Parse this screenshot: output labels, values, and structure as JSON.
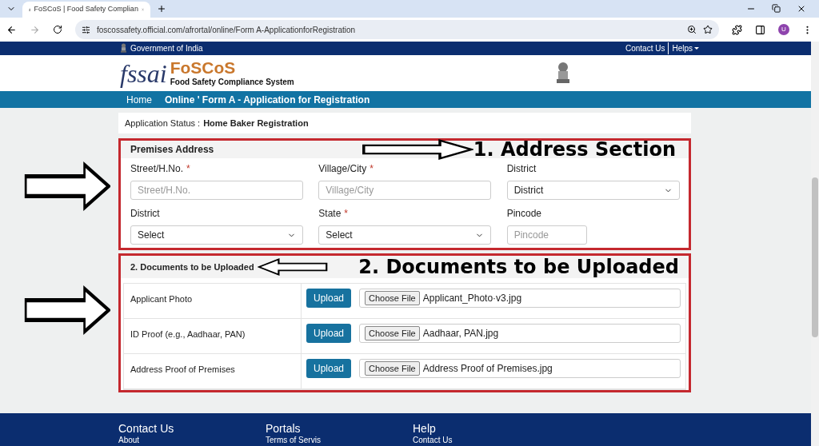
{
  "browser": {
    "tab_title": "FoSCoS | Food Safety Complian",
    "url": "foscossafety.official.com/afrortal/online/Form A-ApplicationforRegistration",
    "avatar": "U"
  },
  "gov_bar": {
    "title": "Government of India",
    "links": [
      "Contact Us",
      "Helps"
    ]
  },
  "header": {
    "logo": "fssai",
    "name": "FoSCoS",
    "subtitle": "Food Safety Compliance System"
  },
  "nav": [
    "Home",
    "Online ' Form A - Application for Registration"
  ],
  "status": {
    "label": "Application Status :",
    "value": "Home Baker Registration"
  },
  "address": {
    "title": "Premises Address",
    "annotation": "1. Address Section",
    "fields": [
      {
        "label": "Street/H.No.",
        "required_mark": "*",
        "kind": "input",
        "placeholder": "Street/H.No."
      },
      {
        "label": "Village/City",
        "required_mark": "*",
        "kind": "input",
        "placeholder": "Village/City"
      },
      {
        "label": "District",
        "kind": "select",
        "value": "District"
      },
      {
        "label": "District",
        "kind": "select",
        "value": "Select"
      },
      {
        "label": "State",
        "required_mark": "*",
        "kind": "select",
        "value": "Select"
      },
      {
        "label": "Pincode",
        "kind": "short_input",
        "placeholder": "Pincode"
      }
    ]
  },
  "documents": {
    "title": "2. Documents to be Uploaded",
    "annotation": "2. Documents to be Uploaded",
    "rows": [
      {
        "label": "Applicant Photo",
        "button": "Upload",
        "file_button": "Choose File",
        "file_name": "Applicant_Photo·v3.jpg"
      },
      {
        "label": "ID Proof (e.g., Aadhaar, PAN)",
        "button": "Upload",
        "file_button": "Choose File",
        "file_name": "Aadhaar, PAN.jpg"
      },
      {
        "label": "Address Proof of Premises",
        "button": "Upload",
        "file_button": "Choose File",
        "file_name": "Address Proof of Premises.jpg"
      }
    ]
  },
  "footer": [
    {
      "title": "Contact Us",
      "link": "About"
    },
    {
      "title": "Portals",
      "link": "Terms of Servis"
    },
    {
      "title": "Help",
      "link": "Contact Us"
    }
  ]
}
